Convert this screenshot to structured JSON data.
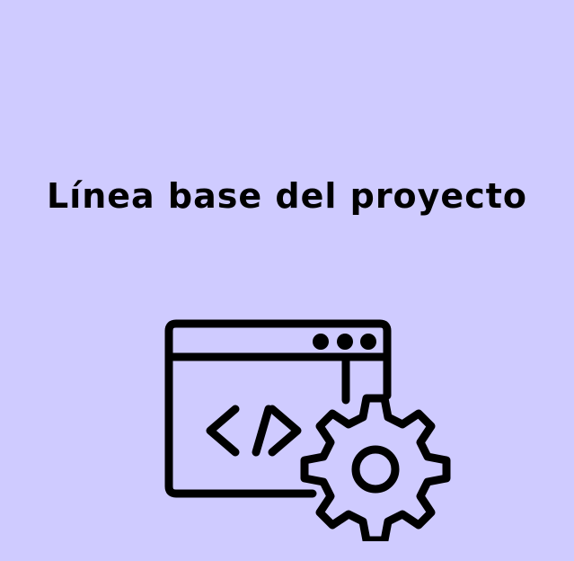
{
  "page": {
    "title": "Línea base del proyecto",
    "background_color": "#cfcbff",
    "text_color": "#000000"
  },
  "illustration": {
    "icons": [
      "code-window-icon",
      "gear-icon"
    ]
  }
}
